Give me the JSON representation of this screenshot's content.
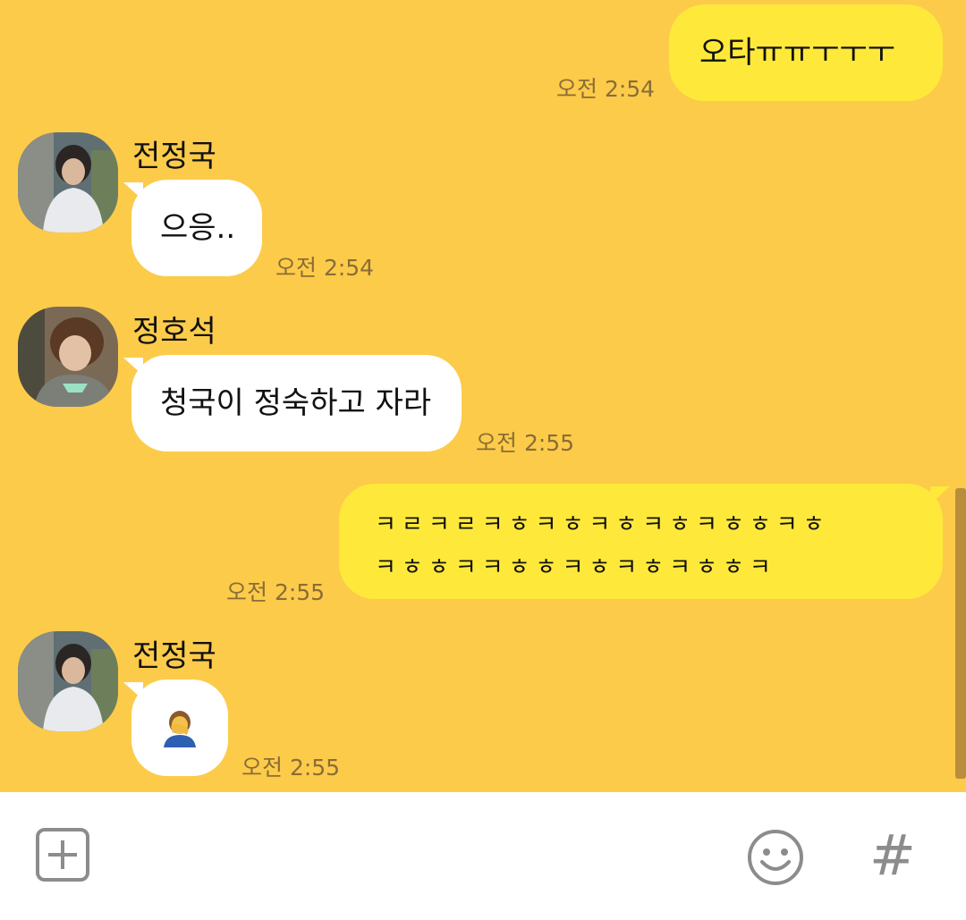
{
  "messages": [
    {
      "from": "me",
      "text": "오타ㅠㅠㅜㅜㅜ",
      "time": "오전 2:54"
    },
    {
      "from": "them",
      "sender": "전정국",
      "text": "으응..",
      "time": "오전 2:54"
    },
    {
      "from": "them",
      "sender": "정호석",
      "text": "청국이 정숙하고 자라",
      "time": "오전 2:55"
    },
    {
      "from": "me",
      "lines": [
        "ㅋㄹㅋㄹㅋㅎㅋㅎㅋㅎㅋㅎㅋㅎㅎㅋㅎ",
        "ㅋㅎㅎㅋㅋㅎㅎㅋㅎㅋㅎㅋㅎㅎㅋ"
      ],
      "time": "오전 2:55"
    },
    {
      "from": "them",
      "sender": "전정국",
      "text": "🤦",
      "emoji_name": "facepalm-emoji",
      "time": "오전 2:55"
    }
  ],
  "input_bar": {
    "add_icon": "plus-square-icon",
    "emoji_icon": "smiley-icon",
    "hash_label": "#"
  },
  "colors": {
    "background": "#fccb4a",
    "my_bubble": "#fee93a",
    "their_bubble": "#ffffff",
    "timestamp": "#8a6d36"
  }
}
